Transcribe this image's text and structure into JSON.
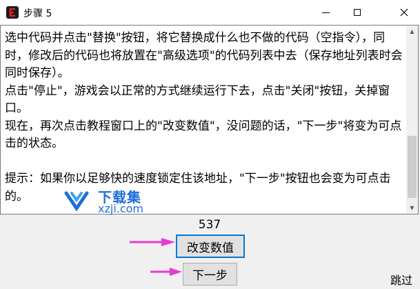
{
  "window": {
    "title": "步骤 5"
  },
  "instructions": {
    "text": "选中代码并点击\"替换\"按钮，将它替换成什么也不做的代码（空指令），同时，修改后的代码也将放置在\"高级选项\"的代码列表中去（保存地址列表时会同时保存）。\n点击\"停止\"，游戏会以正常的方式继续运行下去，点击\"关闭\"按钮，关掉窗口。\n现在，再次点击教程窗口上的\"改变数值\"，没问题的话，\"下一步\"将变为可点击的状态。\n\n提示：如果你以足够快的速度锁定住该地址，\"下一步\"按钮也会变为可点击的。"
  },
  "watermark": {
    "cn": "下载集",
    "en": "xzji.com"
  },
  "main": {
    "counter_value": "537",
    "change_value_label": "改变数值",
    "next_label": "下一步",
    "skip_label": "跳过"
  },
  "colors": {
    "arrow": "#e83ad0",
    "watermark": "#1e6fd9",
    "focus_border": "#0078d7"
  }
}
